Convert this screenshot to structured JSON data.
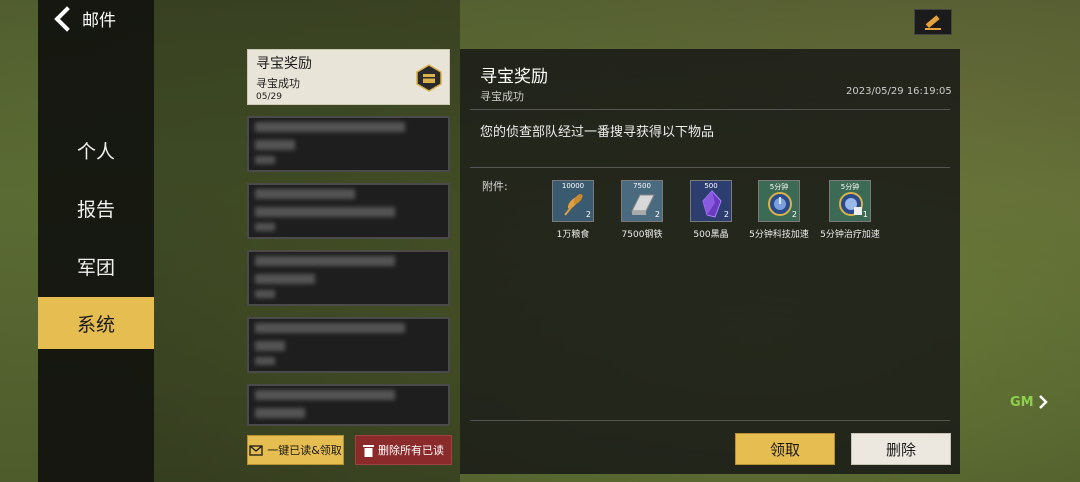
{
  "header": {
    "title": "邮件"
  },
  "nav": {
    "items": [
      {
        "label": "个人"
      },
      {
        "label": "报告"
      },
      {
        "label": "军团"
      },
      {
        "label": "系统"
      }
    ]
  },
  "mail_list": {
    "selected": {
      "title": "寻宝奖励",
      "subtitle": "寻宝成功",
      "date": "05/29"
    },
    "read_all_label": "一键已读&领取",
    "delete_read_label": "删除所有已读"
  },
  "detail": {
    "title": "寻宝奖励",
    "subtitle": "寻宝成功",
    "timestamp": "2023/05/29 16:19:05",
    "body": "您的侦查部队经过一番搜寻获得以下物品",
    "attachments_label": "附件:",
    "items": [
      {
        "top": "10000",
        "count": "2",
        "label": "1万粮食",
        "icon": "wheat-icon",
        "bg": "#3a5a70"
      },
      {
        "top": "7500",
        "count": "2",
        "label": "7500钢铁",
        "icon": "steel-icon",
        "bg": "#4a6a80"
      },
      {
        "top": "500",
        "count": "2",
        "label": "500黑晶",
        "icon": "crystal-icon",
        "bg": "#2c3e70"
      },
      {
        "top": "5分钟",
        "count": "2",
        "label": "5分钟科技加速",
        "icon": "tech-speedup-icon",
        "bg": "#3d6a55"
      },
      {
        "top": "5分钟",
        "count": "1",
        "label": "5分钟治疗加速",
        "icon": "heal-speedup-icon",
        "bg": "#3d6a55"
      }
    ],
    "claim_label": "领取",
    "delete_label": "删除"
  },
  "gm": {
    "label": "GM"
  },
  "colors": {
    "accent": "#e6bd50",
    "danger": "#8a2a2a",
    "gm": "#8fd14f"
  }
}
